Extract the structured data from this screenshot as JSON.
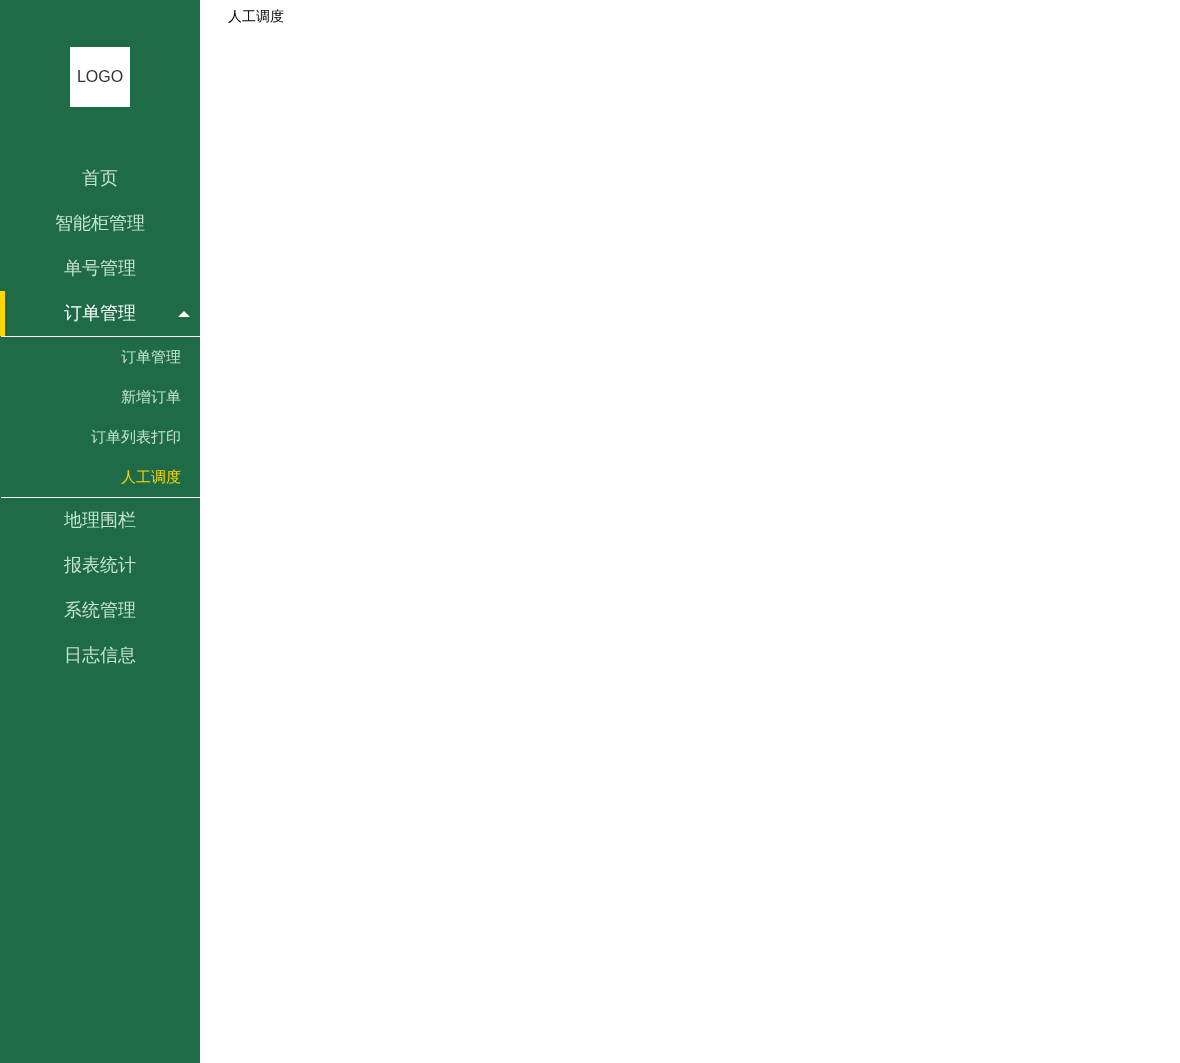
{
  "sidebar": {
    "logo": "LOGO",
    "items": [
      {
        "label": "首页",
        "selected": false,
        "expanded": false
      },
      {
        "label": "智能柜管理",
        "selected": false,
        "expanded": false
      },
      {
        "label": "单号管理",
        "selected": false,
        "expanded": false
      },
      {
        "label": "订单管理",
        "selected": true,
        "expanded": true,
        "children": [
          {
            "label": "订单管理",
            "selected": false
          },
          {
            "label": "新增订单",
            "selected": false
          },
          {
            "label": "订单列表打印",
            "selected": false
          },
          {
            "label": "人工调度",
            "selected": true
          }
        ]
      },
      {
        "label": "地理围栏",
        "selected": false,
        "expanded": false
      },
      {
        "label": "报表统计",
        "selected": false,
        "expanded": false
      },
      {
        "label": "系统管理",
        "selected": false,
        "expanded": false
      },
      {
        "label": "日志信息",
        "selected": false,
        "expanded": false
      }
    ]
  },
  "content": {
    "breadcrumb": "人工调度"
  }
}
